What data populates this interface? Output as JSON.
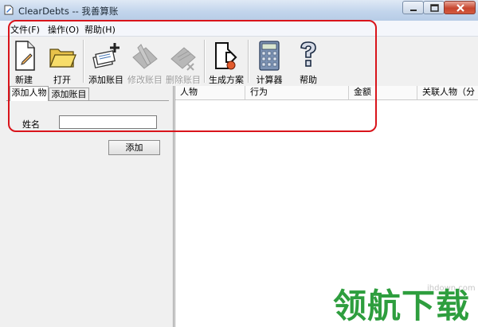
{
  "window": {
    "title": "ClearDebts -- 我善算账"
  },
  "menu": [
    "文件(F)",
    "操作(O)",
    "帮助(H)"
  ],
  "toolbar": [
    {
      "label": "新建",
      "icon": "new-document-icon",
      "enabled": true
    },
    {
      "label": "打开",
      "icon": "open-folder-icon",
      "enabled": true
    },
    {
      "label": "添加账目",
      "icon": "add-entry-icon",
      "enabled": true
    },
    {
      "label": "修改账目",
      "icon": "edit-entry-icon",
      "enabled": false
    },
    {
      "label": "删除账目",
      "icon": "delete-entry-icon",
      "enabled": false
    },
    {
      "label": "生成方案",
      "icon": "generate-plan-icon",
      "enabled": true
    },
    {
      "label": "计算器",
      "icon": "calculator-icon",
      "enabled": true
    },
    {
      "label": "帮助",
      "icon": "help-icon",
      "enabled": true
    }
  ],
  "left_panel": {
    "tabs": [
      "添加人物",
      "添加账目"
    ],
    "name_label": "姓名",
    "name_value": "",
    "add_button": "添加"
  },
  "list": {
    "columns": [
      "人物",
      "行为",
      "金额",
      "关联人物（分"
    ]
  },
  "watermark": {
    "site": "ihdown.com",
    "logo": "领航下载"
  },
  "colors": {
    "annotation": "#d9141b",
    "watermark": "#2e9e3e"
  }
}
